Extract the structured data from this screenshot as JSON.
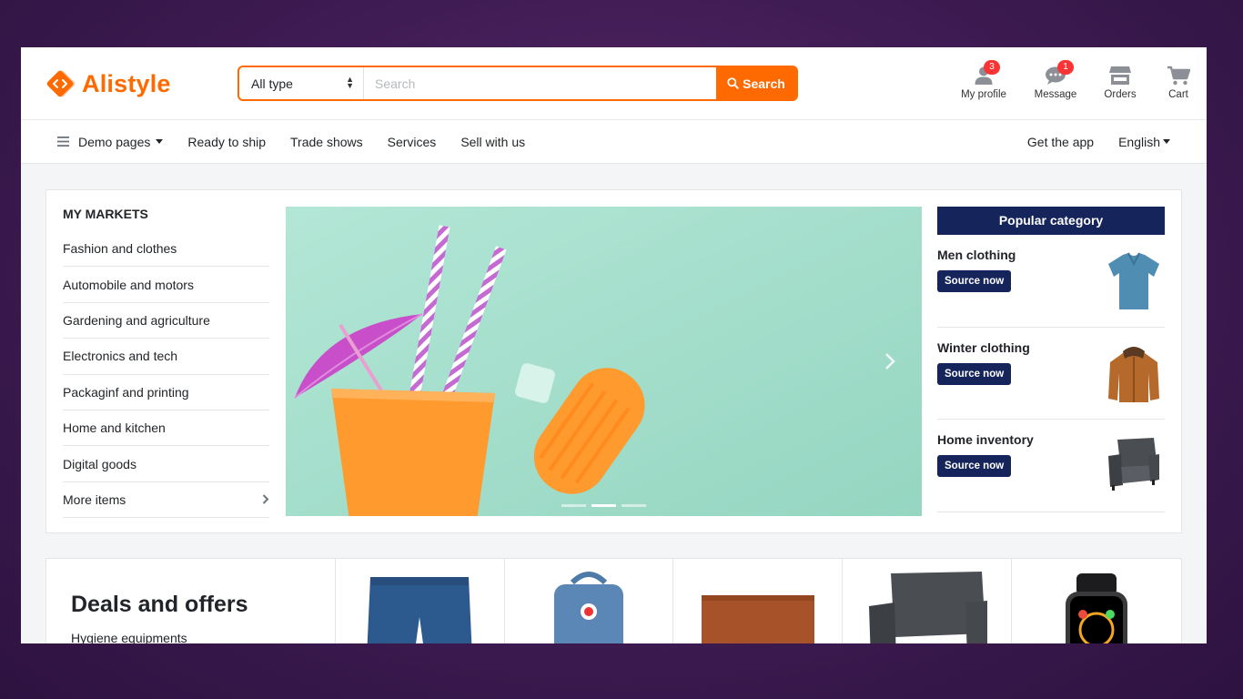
{
  "brand": {
    "name": "Alistyle",
    "accent": "#ff6a00",
    "navy": "#15245a"
  },
  "search": {
    "type_selected": "All type",
    "placeholder": "Search",
    "value": "",
    "button_label": "Search"
  },
  "header_actions": [
    {
      "label": "My profile",
      "icon": "user-icon",
      "badge": "3"
    },
    {
      "label": "Message",
      "icon": "message-icon",
      "badge": "1"
    },
    {
      "label": "Orders",
      "icon": "store-icon",
      "badge": ""
    },
    {
      "label": "Cart",
      "icon": "cart-icon",
      "badge": ""
    }
  ],
  "nav": {
    "menu_label": "Demo pages",
    "items": [
      "Ready to ship",
      "Trade shows",
      "Services",
      "Sell with us"
    ],
    "get_app": "Get the app",
    "language": "English"
  },
  "markets": {
    "title": "MY MARKETS",
    "items": [
      "Fashion and clothes",
      "Automobile and motors",
      "Gardening and agriculture",
      "Electronics and tech",
      "Packaginf and printing",
      "Home and kitchen",
      "Digital goods",
      "More items"
    ]
  },
  "banner": {
    "slide_count": 3,
    "active_slide": 2
  },
  "popular": {
    "title": "Popular category",
    "items": [
      {
        "title": "Men clothing",
        "button": "Source now",
        "icon": "polo-shirt-icon"
      },
      {
        "title": "Winter clothing",
        "button": "Source now",
        "icon": "winter-jacket-icon"
      },
      {
        "title": "Home inventory",
        "button": "Source now",
        "icon": "armchair-icon"
      }
    ]
  },
  "deals": {
    "title": "Deals and offers",
    "subtitle": "Hygiene equipments",
    "products": [
      "jeans-shorts-icon",
      "backpack-icon",
      "laptop-sleeve-icon",
      "armchair-icon",
      "smartwatch-icon"
    ]
  }
}
